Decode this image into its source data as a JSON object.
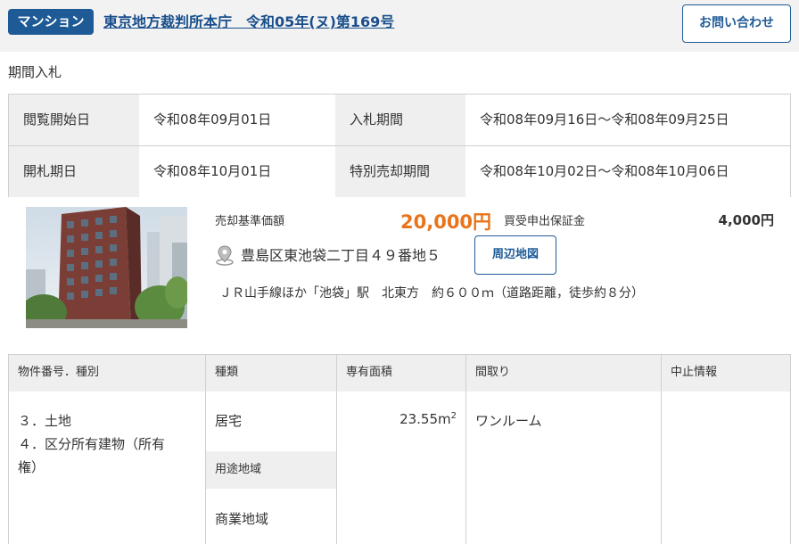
{
  "header": {
    "badge": "マンション",
    "case_title": "東京地方裁判所本庁　令和05年(ヌ)第169号",
    "contact_label": "お問い合わせ"
  },
  "sale_method": "期間入札",
  "schedule": {
    "viewing_start_label": "閲覧開始日",
    "viewing_start_value": "令和08年09月01日",
    "bid_period_label": "入札期間",
    "bid_period_value": "令和08年09月16日～令和08年09月25日",
    "opening_label": "開札期日",
    "opening_value": "令和08年10月01日",
    "special_sale_label": "特別売却期間",
    "special_sale_value": "令和08年10月02日～令和08年10月06日"
  },
  "summary": {
    "base_price_label": "売却基準価額",
    "base_price_value": "20,000円",
    "deposit_label": "買受申出保証金",
    "deposit_value": "4,000円",
    "address": "豊島区東池袋二丁目４９番地５",
    "map_button": "周辺地図",
    "access": "ＪＲ山手線ほか「池袋」駅　北東方　約６００ｍ（道路距離，徒歩約８分）"
  },
  "property_table": {
    "headers": {
      "number_type": "物件番号．種別",
      "kind": "種類",
      "area": "専有面積",
      "layout": "間取り",
      "cancel": "中止情報"
    },
    "items": [
      "３．土地",
      "４．区分所有建物（所有",
      "権）"
    ],
    "kind_value": "居宅",
    "area_value": "23.55m",
    "area_unit_sup": "2",
    "layout_value": "ワンルーム",
    "zoning_label": "用途地域",
    "zoning_value": "商業地域"
  },
  "colors": {
    "accent": "#1e5a96",
    "price": "#e8741b",
    "label_bg": "#efefef"
  }
}
